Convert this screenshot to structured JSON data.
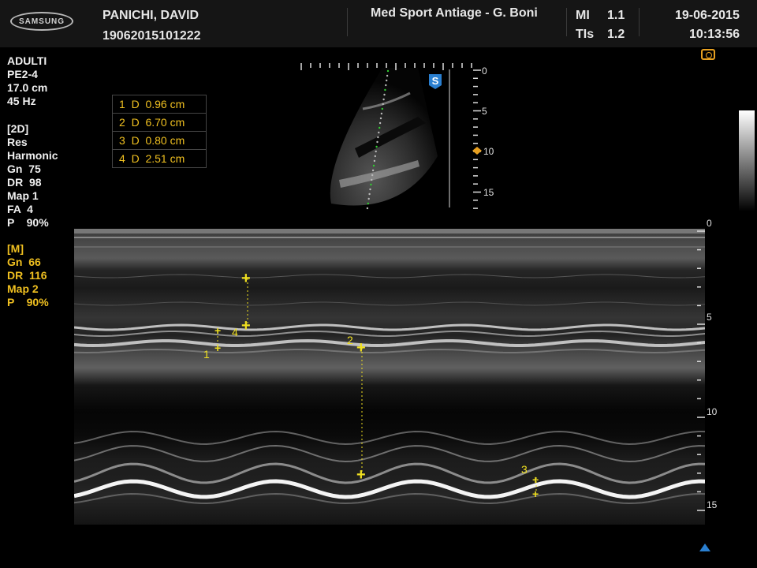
{
  "header": {
    "logo_text": "SAMSUNG",
    "patient_name": "PANICHI, DAVID",
    "patient_id": "19062015101222",
    "institution": "Med Sport Antiage - G. Boni",
    "mi_label": "MI",
    "mi_value": "1.1",
    "tis_label": "TIs",
    "tis_value": "1.2",
    "date": "19-06-2015",
    "time": "10:13:56"
  },
  "left_panel": {
    "general": [
      "ADULTI",
      "PE2-4",
      "17.0 cm",
      "45 Hz"
    ],
    "mode_2d": [
      "[2D]",
      "Res",
      "Harmonic",
      "Gn  75",
      "DR  98",
      "Map 1",
      "FA  4",
      "P    90%"
    ],
    "mode_m": [
      "[M]",
      "Gn  66",
      "DR  116",
      "Map 2",
      "P    90%"
    ]
  },
  "measurements": [
    {
      "index": "1",
      "type": "D",
      "value": "0.96 cm"
    },
    {
      "index": "2",
      "type": "D",
      "value": "6.70 cm"
    },
    {
      "index": "3",
      "type": "D",
      "value": "0.80 cm"
    },
    {
      "index": "4",
      "type": "D",
      "value": "2.51 cm"
    }
  ],
  "sector_scale": [
    "0",
    "5",
    "10",
    "15"
  ],
  "sector_marker": "S",
  "mmode_scale": [
    "0",
    "5",
    "10",
    "15"
  ],
  "caliper_labels": [
    "1",
    "2",
    "3",
    "4"
  ],
  "colors": {
    "header_bg": "#151515",
    "yellow": "#f0c020",
    "caliper": "#f0e020",
    "marker_blue": "#2a7fd0",
    "depth_marker": "#e8a020"
  },
  "icons": {
    "camera": "camera-icon",
    "grayscale": "grayscale-bar",
    "sector_marker": "orientation-marker-icon",
    "sweep_indicator": "triangle-up-icon"
  }
}
